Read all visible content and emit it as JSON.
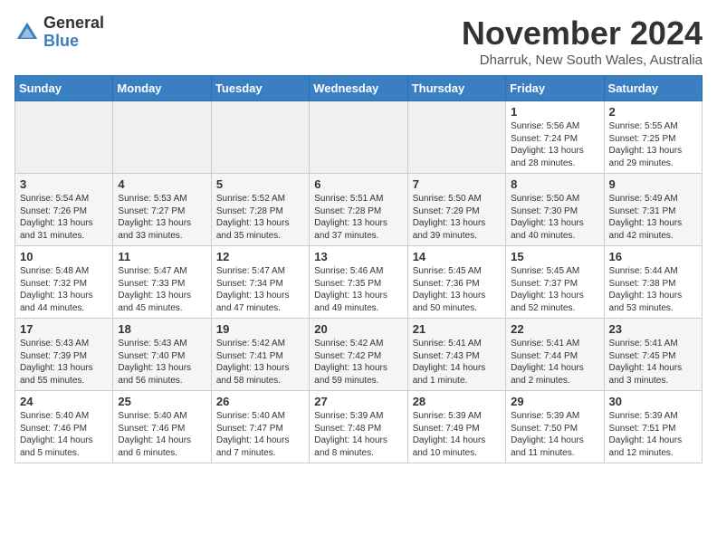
{
  "logo": {
    "general": "General",
    "blue": "Blue"
  },
  "title": "November 2024",
  "subtitle": "Dharruk, New South Wales, Australia",
  "headers": [
    "Sunday",
    "Monday",
    "Tuesday",
    "Wednesday",
    "Thursday",
    "Friday",
    "Saturday"
  ],
  "weeks": [
    {
      "shaded": false,
      "days": [
        {
          "num": "",
          "info": "",
          "empty": true
        },
        {
          "num": "",
          "info": "",
          "empty": true
        },
        {
          "num": "",
          "info": "",
          "empty": true
        },
        {
          "num": "",
          "info": "",
          "empty": true
        },
        {
          "num": "",
          "info": "",
          "empty": true
        },
        {
          "num": "1",
          "info": "Sunrise: 5:56 AM\nSunset: 7:24 PM\nDaylight: 13 hours\nand 28 minutes."
        },
        {
          "num": "2",
          "info": "Sunrise: 5:55 AM\nSunset: 7:25 PM\nDaylight: 13 hours\nand 29 minutes."
        }
      ]
    },
    {
      "shaded": true,
      "days": [
        {
          "num": "3",
          "info": "Sunrise: 5:54 AM\nSunset: 7:26 PM\nDaylight: 13 hours\nand 31 minutes."
        },
        {
          "num": "4",
          "info": "Sunrise: 5:53 AM\nSunset: 7:27 PM\nDaylight: 13 hours\nand 33 minutes."
        },
        {
          "num": "5",
          "info": "Sunrise: 5:52 AM\nSunset: 7:28 PM\nDaylight: 13 hours\nand 35 minutes."
        },
        {
          "num": "6",
          "info": "Sunrise: 5:51 AM\nSunset: 7:28 PM\nDaylight: 13 hours\nand 37 minutes."
        },
        {
          "num": "7",
          "info": "Sunrise: 5:50 AM\nSunset: 7:29 PM\nDaylight: 13 hours\nand 39 minutes."
        },
        {
          "num": "8",
          "info": "Sunrise: 5:50 AM\nSunset: 7:30 PM\nDaylight: 13 hours\nand 40 minutes."
        },
        {
          "num": "9",
          "info": "Sunrise: 5:49 AM\nSunset: 7:31 PM\nDaylight: 13 hours\nand 42 minutes."
        }
      ]
    },
    {
      "shaded": false,
      "days": [
        {
          "num": "10",
          "info": "Sunrise: 5:48 AM\nSunset: 7:32 PM\nDaylight: 13 hours\nand 44 minutes."
        },
        {
          "num": "11",
          "info": "Sunrise: 5:47 AM\nSunset: 7:33 PM\nDaylight: 13 hours\nand 45 minutes."
        },
        {
          "num": "12",
          "info": "Sunrise: 5:47 AM\nSunset: 7:34 PM\nDaylight: 13 hours\nand 47 minutes."
        },
        {
          "num": "13",
          "info": "Sunrise: 5:46 AM\nSunset: 7:35 PM\nDaylight: 13 hours\nand 49 minutes."
        },
        {
          "num": "14",
          "info": "Sunrise: 5:45 AM\nSunset: 7:36 PM\nDaylight: 13 hours\nand 50 minutes."
        },
        {
          "num": "15",
          "info": "Sunrise: 5:45 AM\nSunset: 7:37 PM\nDaylight: 13 hours\nand 52 minutes."
        },
        {
          "num": "16",
          "info": "Sunrise: 5:44 AM\nSunset: 7:38 PM\nDaylight: 13 hours\nand 53 minutes."
        }
      ]
    },
    {
      "shaded": true,
      "days": [
        {
          "num": "17",
          "info": "Sunrise: 5:43 AM\nSunset: 7:39 PM\nDaylight: 13 hours\nand 55 minutes."
        },
        {
          "num": "18",
          "info": "Sunrise: 5:43 AM\nSunset: 7:40 PM\nDaylight: 13 hours\nand 56 minutes."
        },
        {
          "num": "19",
          "info": "Sunrise: 5:42 AM\nSunset: 7:41 PM\nDaylight: 13 hours\nand 58 minutes."
        },
        {
          "num": "20",
          "info": "Sunrise: 5:42 AM\nSunset: 7:42 PM\nDaylight: 13 hours\nand 59 minutes."
        },
        {
          "num": "21",
          "info": "Sunrise: 5:41 AM\nSunset: 7:43 PM\nDaylight: 14 hours\nand 1 minute."
        },
        {
          "num": "22",
          "info": "Sunrise: 5:41 AM\nSunset: 7:44 PM\nDaylight: 14 hours\nand 2 minutes."
        },
        {
          "num": "23",
          "info": "Sunrise: 5:41 AM\nSunset: 7:45 PM\nDaylight: 14 hours\nand 3 minutes."
        }
      ]
    },
    {
      "shaded": false,
      "days": [
        {
          "num": "24",
          "info": "Sunrise: 5:40 AM\nSunset: 7:46 PM\nDaylight: 14 hours\nand 5 minutes."
        },
        {
          "num": "25",
          "info": "Sunrise: 5:40 AM\nSunset: 7:46 PM\nDaylight: 14 hours\nand 6 minutes."
        },
        {
          "num": "26",
          "info": "Sunrise: 5:40 AM\nSunset: 7:47 PM\nDaylight: 14 hours\nand 7 minutes."
        },
        {
          "num": "27",
          "info": "Sunrise: 5:39 AM\nSunset: 7:48 PM\nDaylight: 14 hours\nand 8 minutes."
        },
        {
          "num": "28",
          "info": "Sunrise: 5:39 AM\nSunset: 7:49 PM\nDaylight: 14 hours\nand 10 minutes."
        },
        {
          "num": "29",
          "info": "Sunrise: 5:39 AM\nSunset: 7:50 PM\nDaylight: 14 hours\nand 11 minutes."
        },
        {
          "num": "30",
          "info": "Sunrise: 5:39 AM\nSunset: 7:51 PM\nDaylight: 14 hours\nand 12 minutes."
        }
      ]
    }
  ]
}
